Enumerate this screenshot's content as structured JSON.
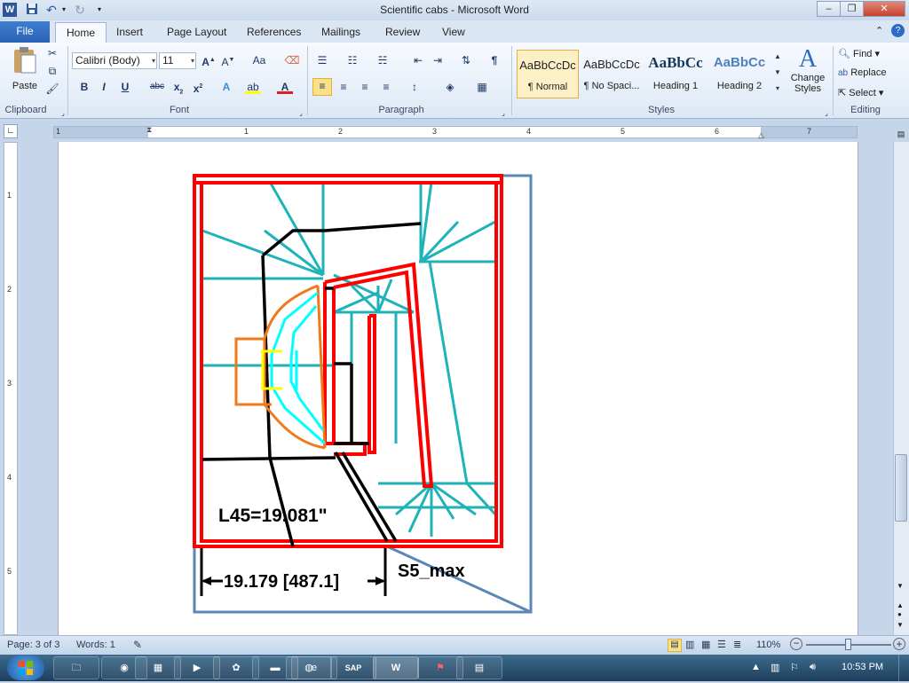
{
  "window": {
    "title": "Scientific cabs  -  Microsoft Word",
    "minimize": "–",
    "restore": "❐",
    "close": "✕"
  },
  "qat": {
    "word_icon": "W",
    "save_icon": "save-icon",
    "undo_icon": "undo-icon",
    "redo_icon": "redo-icon"
  },
  "tabs": [
    "File",
    "Home",
    "Insert",
    "Page Layout",
    "References",
    "Mailings",
    "Review",
    "View"
  ],
  "ribbon": {
    "clipboard": {
      "label": "Clipboard",
      "paste": "Paste"
    },
    "font": {
      "label": "Font",
      "family": "Calibri (Body)",
      "size": "11",
      "change_case": "Aa"
    },
    "paragraph": {
      "label": "Paragraph"
    },
    "styles": {
      "label": "Styles",
      "items": [
        {
          "sample": "AaBbCcDc",
          "name": "¶ Normal"
        },
        {
          "sample": "AaBbCcDc",
          "name": "¶ No Spaci..."
        },
        {
          "sample": "AaBbCc",
          "name": "Heading 1"
        },
        {
          "sample": "AaBbCc",
          "name": "Heading 2"
        }
      ],
      "change_styles": "Change Styles"
    },
    "editing": {
      "label": "Editing",
      "find": "Find",
      "replace": "Replace",
      "select": "Select"
    }
  },
  "ruler": {
    "numbers": [
      "1",
      "1",
      "2",
      "3",
      "4",
      "5",
      "6",
      "7"
    ],
    "vnumbers": [
      "1",
      "2",
      "3",
      "4",
      "5"
    ]
  },
  "drawing": {
    "dimension_label": "L45=19.081\"",
    "width_label": "19.179  [487.1]",
    "slot_label": "S5_max"
  },
  "status": {
    "page": "Page: 3 of 3",
    "words": "Words: 1",
    "zoom": "110%"
  },
  "taskbar": {
    "clock": "10:53 PM",
    "sap": "SAP"
  },
  "colors": {
    "red": "#ff0000",
    "teal": "#1fb3b8",
    "black": "#000000",
    "orange": "#f07a1a",
    "cyan": "#00ffff",
    "yellow": "#ffff00",
    "blue_outline": "#5a86b8"
  }
}
